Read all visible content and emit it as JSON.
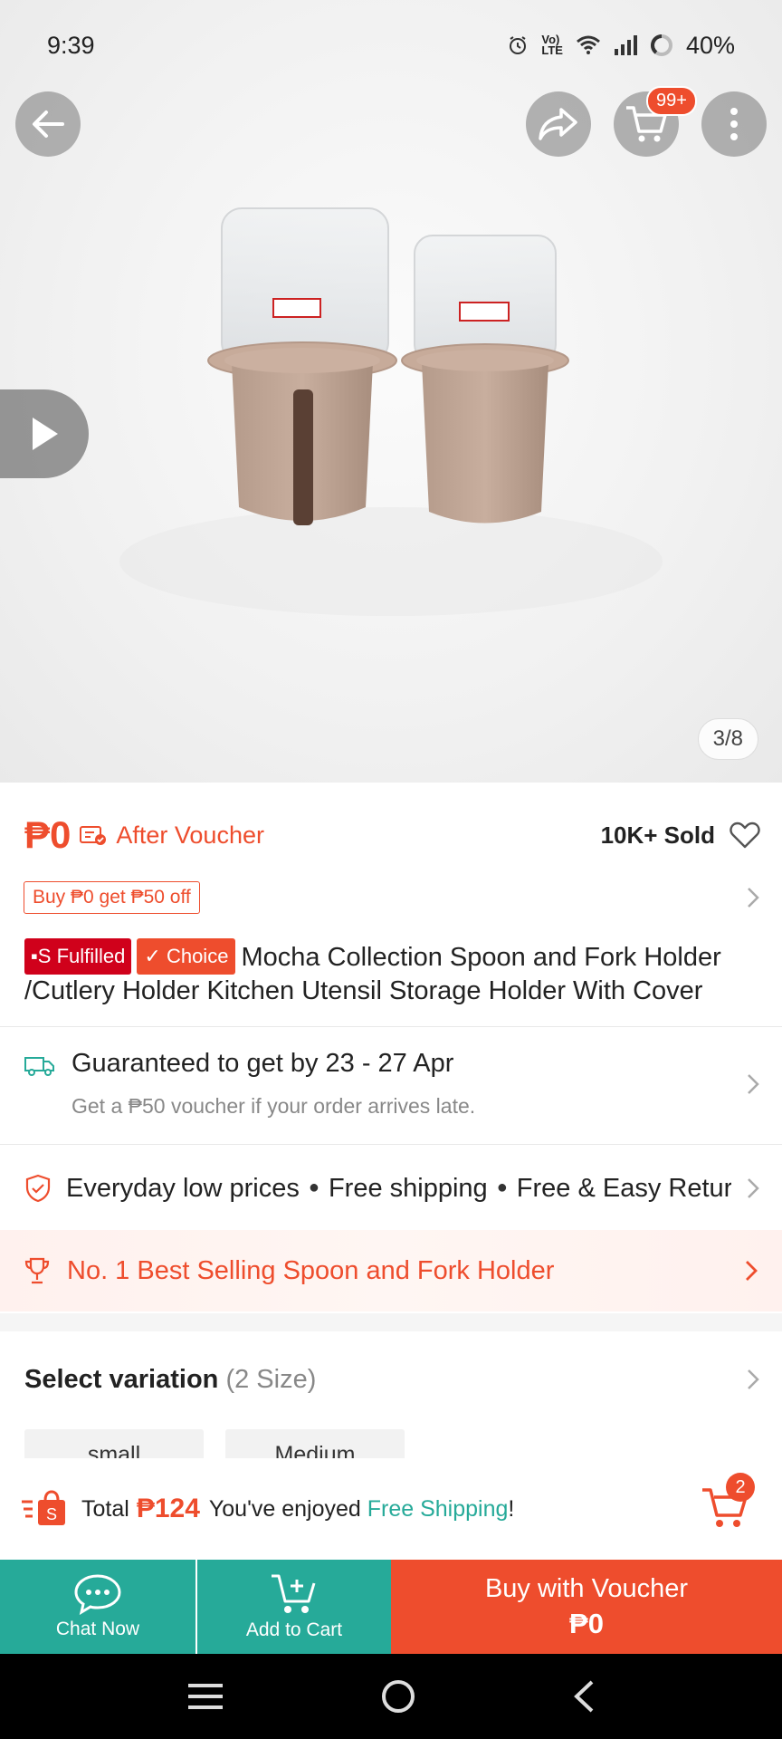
{
  "status_bar": {
    "time": "9:39",
    "battery": "40%",
    "icons": [
      "alarm-icon",
      "volte-icon",
      "wifi-icon",
      "signal-icon",
      "battery-ring-icon"
    ]
  },
  "header": {
    "cart_badge": "99+"
  },
  "gallery": {
    "counter": "3/8"
  },
  "product": {
    "price": "₱0",
    "after_voucher": "After Voucher",
    "sold": "10K+ Sold",
    "promo_tag": "Buy ₱0 get ₱50 off",
    "badge_fulfilled": "Fulfilled",
    "badge_choice": "Choice",
    "title": "Mocha Collection Spoon and Fork Holder /Cutlery Holder Kitchen Utensil Storage Holder With Cover"
  },
  "shipping": {
    "main": "Guaranteed to get by 23 - 27 Apr",
    "sub": "Get a ₱50 voucher if your order arrives late."
  },
  "guarantees": {
    "items": [
      "Everyday low prices",
      "Free shipping",
      "Free & Easy Returns"
    ]
  },
  "best_selling": {
    "label": "No. 1 Best Selling Spoon and Fork Holder"
  },
  "variation": {
    "title": "Select variation",
    "count": "(2 Size)",
    "options": [
      "small",
      "Medium"
    ]
  },
  "total_strip": {
    "total_label": "Total",
    "total_price": "₱124",
    "enjoyed_text": "You've enjoyed",
    "free_shipping": "Free Shipping",
    "exclaim": "!",
    "cart_count": "2"
  },
  "actions": {
    "chat_now": "Chat Now",
    "add_to_cart": "Add to Cart",
    "buy_label": "Buy with Voucher",
    "buy_price": "₱0"
  },
  "colors": {
    "accent": "#ee4d2d",
    "teal": "#26aa99"
  }
}
